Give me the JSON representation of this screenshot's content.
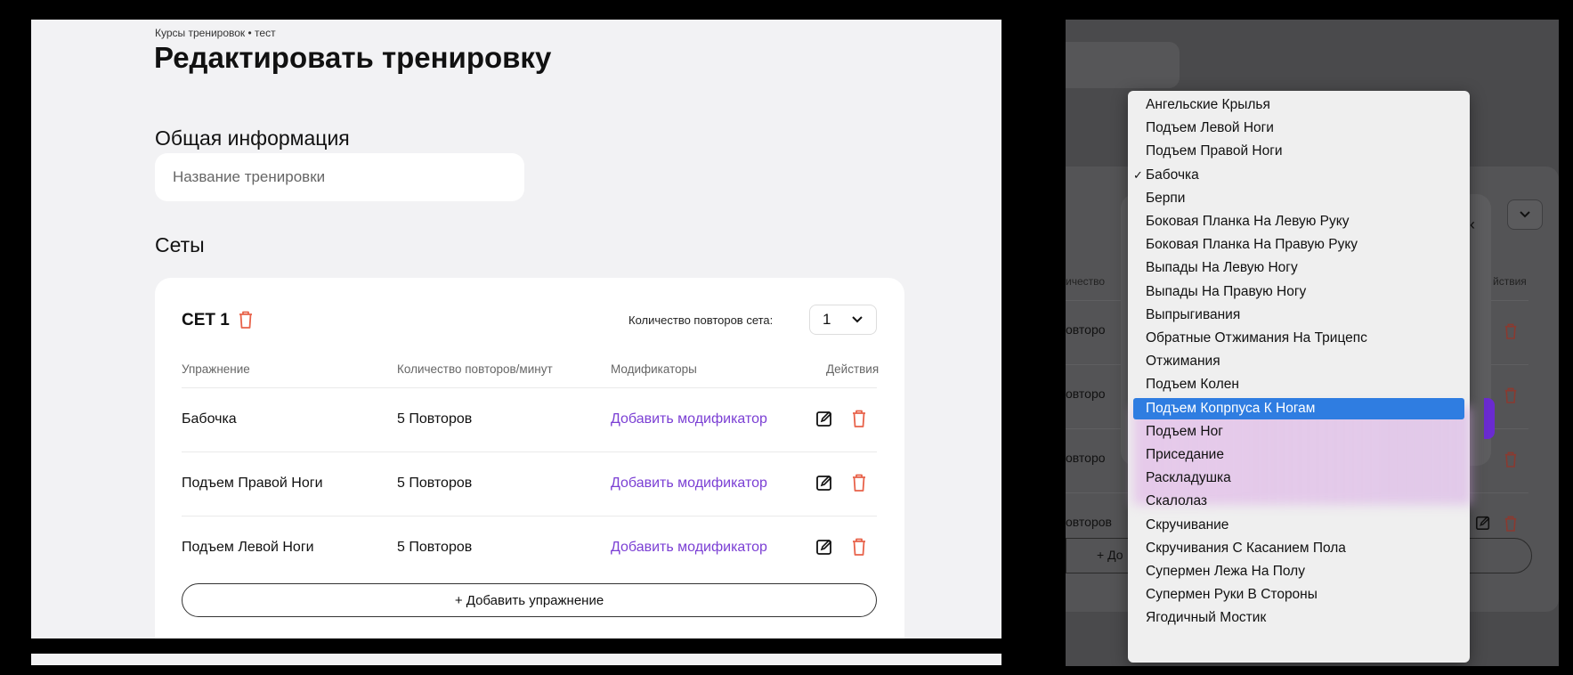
{
  "left": {
    "breadcrumb": "Курсы тренировок • тест",
    "title": "Редактировать тренировку",
    "general_heading": "Общая информация",
    "name_placeholder": "Название тренировки",
    "sets_heading": "Сеты",
    "set": {
      "title": "СЕТ 1",
      "reps_label": "Количество повторов сета:",
      "reps_value": "1",
      "columns": [
        "Упражнение",
        "Количество повторов/минут",
        "Модификаторы",
        "Действия"
      ],
      "rows": [
        {
          "exercise": "Бабочка",
          "reps": "5 Повторов",
          "modifier": "Добавить модификатор"
        },
        {
          "exercise": "Подъем Правой Ноги",
          "reps": "5 Повторов",
          "modifier": "Добавить модификатор"
        },
        {
          "exercise": "Подъем Левой Ноги",
          "reps": "5 Повторов",
          "modifier": "Добавить модификатор"
        }
      ],
      "add_exercise": "+ Добавить упражнение"
    }
  },
  "right": {
    "bg_fragments": {
      "col_reps": "ичество",
      "col_actions": "йствия",
      "row_reps": [
        "овторо",
        "овторо",
        "овторо",
        "овторов"
      ],
      "add": "+ До"
    },
    "dropdown": {
      "items": [
        "Ангельские Крылья",
        "Подъем Левой Ноги",
        "Подъем Правой Ноги",
        "Бабочка",
        "Берпи",
        "Боковая Планка На Левую Руку",
        "Боковая Планка На Правую Руку",
        "Выпады На Левую Ногу",
        "Выпады На Правую Ногу",
        "Выпрыгивания",
        "Обратные Отжимания На Трицепс",
        "Отжимания",
        "Подъем Колен",
        "Подъем Копрпуса К Ногам",
        "Подъем Ног",
        "Приседание",
        "Раскладушка",
        "Скалолаз",
        "Скручивание",
        "Скручивания С Касанием Пола",
        "Супермен Лежа На Полу",
        "Супермен Руки В Стороны",
        "Ягодичный Мостик"
      ],
      "checked_index": 3,
      "highlighted_index": 13,
      "check_mark": "✓"
    }
  },
  "colors": {
    "accent_purple": "#7b3fd4",
    "danger": "#e8624a",
    "highlight_blue": "#2f7de1"
  }
}
